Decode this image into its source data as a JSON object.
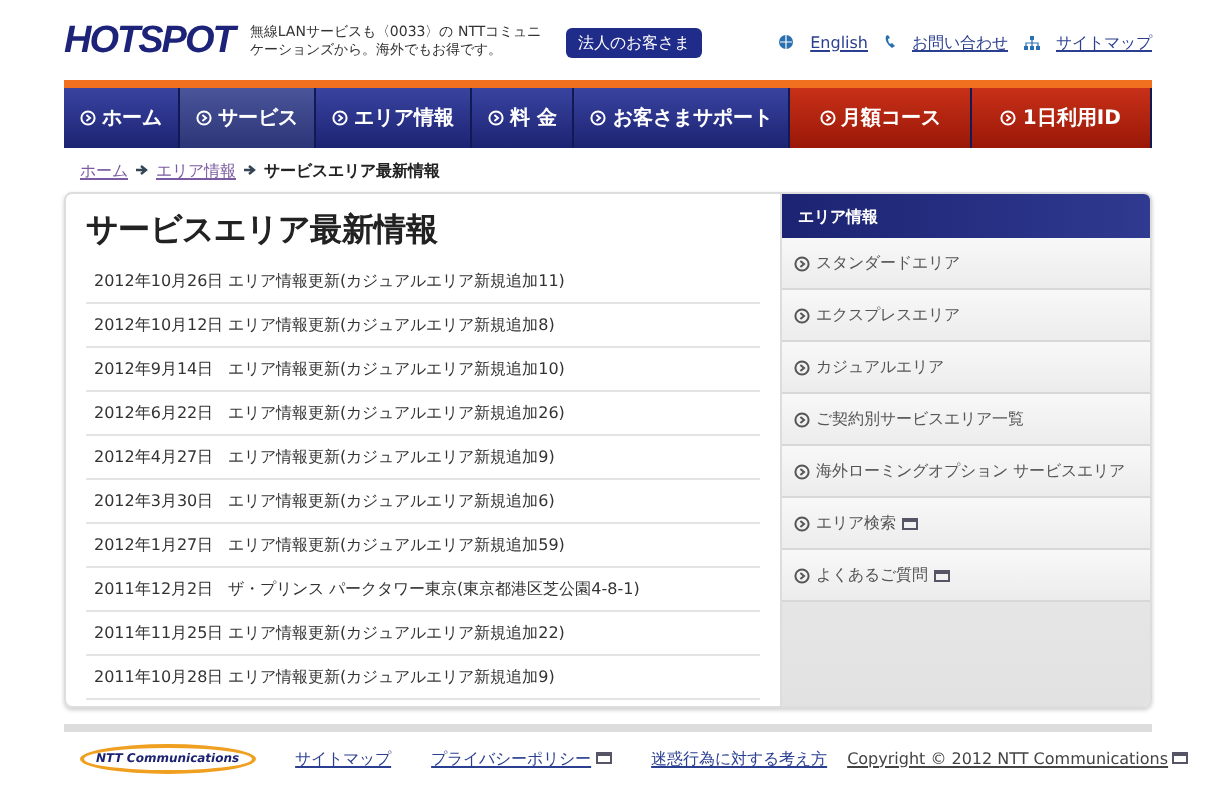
{
  "header": {
    "logo": "HOTSPOT",
    "tagline": "無線LANサービスも〈0033〉の NTTコミュニケーションズから。海外でもお得です。",
    "business_button": "法人のお客さま",
    "links": [
      {
        "label": "English"
      },
      {
        "label": "お問い合わせ"
      },
      {
        "label": "サイトマップ"
      }
    ]
  },
  "nav": [
    {
      "label": "ホーム",
      "selected": false,
      "kind": "main"
    },
    {
      "label": "サービス",
      "selected": true,
      "kind": "main"
    },
    {
      "label": "エリア情報",
      "selected": false,
      "kind": "main"
    },
    {
      "label": "料 金",
      "selected": false,
      "kind": "main"
    },
    {
      "label": "お客さまサポート",
      "selected": false,
      "kind": "main"
    },
    {
      "label": "月額コース",
      "selected": false,
      "kind": "plan"
    },
    {
      "label": "1日利用ID",
      "selected": false,
      "kind": "plan"
    }
  ],
  "breadcrumb": [
    {
      "label": "ホーム",
      "link": true
    },
    {
      "label": "エリア情報",
      "link": true
    },
    {
      "label": "サービスエリア最新情報",
      "link": false
    }
  ],
  "title": "サービスエリア最新情報",
  "news": [
    {
      "date": "2012年10月26日",
      "text": "エリア情報更新(カジュアルエリア新規追加11)"
    },
    {
      "date": "2012年10月12日",
      "text": "エリア情報更新(カジュアルエリア新規追加8)"
    },
    {
      "date": "2012年9月14日",
      "text": "エリア情報更新(カジュアルエリア新規追加10)"
    },
    {
      "date": "2012年6月22日",
      "text": "エリア情報更新(カジュアルエリア新規追加26)"
    },
    {
      "date": "2012年4月27日",
      "text": "エリア情報更新(カジュアルエリア新規追加9)"
    },
    {
      "date": "2012年3月30日",
      "text": "エリア情報更新(カジュアルエリア新規追加6)"
    },
    {
      "date": "2012年1月27日",
      "text": "エリア情報更新(カジュアルエリア新規追加59)"
    },
    {
      "date": "2011年12月2日",
      "text": "ザ・プリンス パークタワー東京(東京都港区芝公園4-8-1)"
    },
    {
      "date": "2011年11月25日",
      "text": "エリア情報更新(カジュアルエリア新規追加22)"
    },
    {
      "date": "2011年10月28日",
      "text": "エリア情報更新(カジュアルエリア新規追加9)"
    }
  ],
  "sidebar": {
    "heading": "エリア情報",
    "items": [
      {
        "label": "スタンダードエリア",
        "external": false
      },
      {
        "label": "エクスプレスエリア",
        "external": false
      },
      {
        "label": "カジュアルエリア",
        "external": false
      },
      {
        "label": "ご契約別サービスエリア一覧",
        "external": false
      },
      {
        "label": "海外ローミングオプション サービスエリア",
        "external": false
      },
      {
        "label": "エリア検索",
        "external": true
      },
      {
        "label": "よくあるご質問",
        "external": true
      }
    ]
  },
  "footer": {
    "logo": "NTT Communications",
    "links": [
      {
        "label": "サイトマップ",
        "external": false
      },
      {
        "label": "プライバシーポリシー",
        "external": true
      },
      {
        "label": "迷惑行為に対する考え方",
        "external": false
      }
    ],
    "copyright": "Copyright © 2012 NTT Communications",
    "copyright_external": true
  }
}
